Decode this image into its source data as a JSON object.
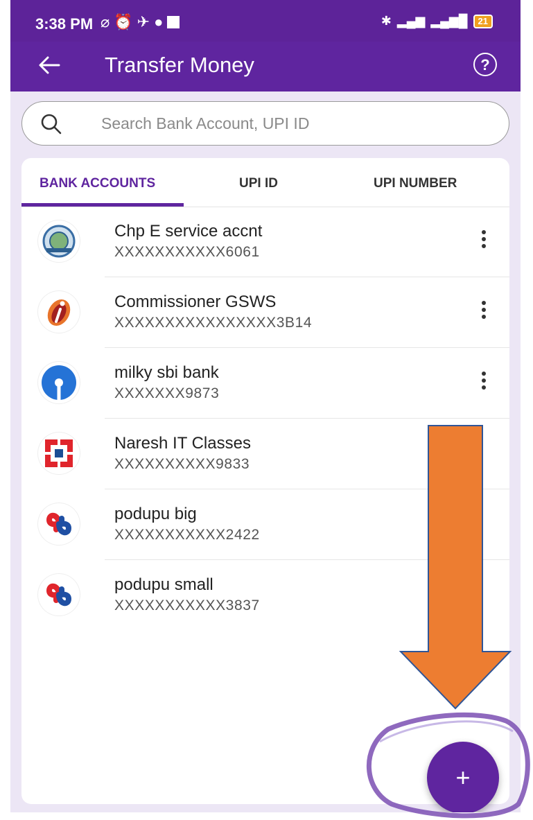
{
  "status_bar": {
    "time": "3:38 PM",
    "battery": "21"
  },
  "app_bar": {
    "title": "Transfer Money",
    "back_icon": "arrow-left-icon",
    "help_icon": "question-circle-icon",
    "help_glyph": "?"
  },
  "search": {
    "placeholder": "Search Bank Account, UPI ID",
    "value": ""
  },
  "tabs": [
    {
      "label": "BANK ACCOUNTS",
      "active": true
    },
    {
      "label": "UPI ID",
      "active": false
    },
    {
      "label": "UPI NUMBER",
      "active": false
    }
  ],
  "accounts": [
    {
      "name": "Chp E service accnt",
      "number": "XXXXXXXXXXX6061",
      "bank_icon": "emblem-bank-logo",
      "menu": true
    },
    {
      "name": "Commissioner GSWS",
      "number": "XXXXXXXXXXXXXXXX3B14",
      "bank_icon": "icici-bank-logo",
      "menu": true
    },
    {
      "name": "milky sbi bank",
      "number": "XXXXXXX9873",
      "bank_icon": "sbi-bank-logo",
      "menu": true
    },
    {
      "name": "Naresh IT Classes",
      "number": "XXXXXXXXXX9833",
      "bank_icon": "hdfc-bank-logo",
      "menu": false
    },
    {
      "name": "podupu big",
      "number": "XXXXXXXXXXX2422",
      "bank_icon": "bob-bank-logo",
      "menu": false
    },
    {
      "name": "podupu small",
      "number": "XXXXXXXXXXX3837",
      "bank_icon": "bob-bank-logo",
      "menu": false
    }
  ],
  "fab": {
    "label": "+",
    "icon": "plus-icon"
  },
  "annotation": {
    "arrow_color": "#ed7d31",
    "circle_color": "#7b4fb3"
  },
  "colors": {
    "brand": "#5f259f",
    "background": "#ece6f5"
  }
}
